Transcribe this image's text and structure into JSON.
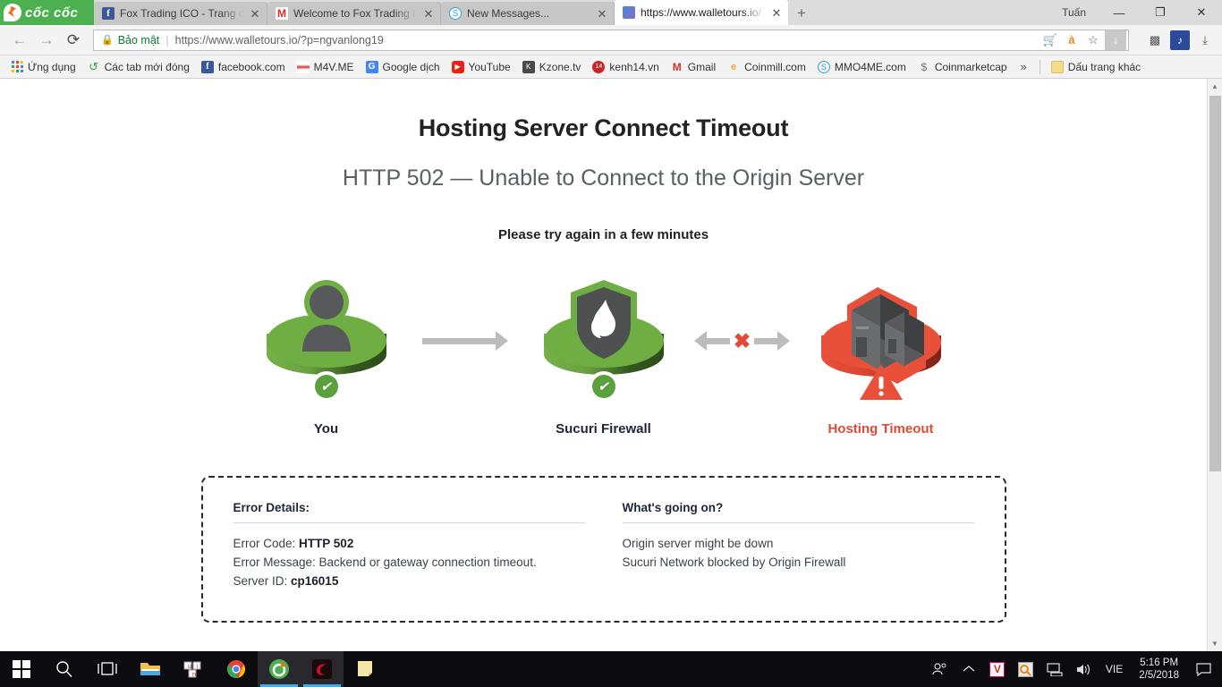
{
  "window": {
    "brand": "cốc cốc",
    "user": "Tuấn",
    "minimize": "—",
    "maximize": "❐",
    "close": "✕"
  },
  "tabs": [
    {
      "title": "Fox Trading ICO - Trang ch",
      "favicon": "facebook-icon",
      "close": "✕",
      "active": false
    },
    {
      "title": "Welcome to Fox Trading IC",
      "favicon": "gmail-icon",
      "close": "✕",
      "active": false
    },
    {
      "title": "New Messages...",
      "favicon": "skype-icon",
      "close": "✕",
      "active": false
    },
    {
      "title": "https://www.walletours.io/",
      "favicon": "walletours-icon",
      "close": "✕",
      "active": true
    }
  ],
  "newtab_label": "+",
  "nav": {
    "back": "←",
    "forward": "→",
    "reload": "⟳",
    "lock_icon": "lock-icon",
    "secure_label": "Bảo mật",
    "separator": "|",
    "url_scheme": "https://",
    "url_host": "www.walletours.io",
    "url_path": "/?p=ngvanlong19",
    "url_full": "https://www.walletours.io/?p=ngvanlong19",
    "actions": [
      {
        "name": "shopping-cart-icon",
        "glyph": "🛒"
      },
      {
        "name": "translate-icon",
        "glyph": "à"
      },
      {
        "name": "bookmark-star-icon",
        "glyph": "☆"
      },
      {
        "name": "download-arrow-icon",
        "glyph": "↓"
      }
    ],
    "extensions": [
      {
        "name": "qr-code-icon",
        "glyph": "▩"
      },
      {
        "name": "blue-extension-icon",
        "glyph": "♪"
      },
      {
        "name": "downloads-icon",
        "glyph": "⤓"
      }
    ]
  },
  "bookmarks": {
    "items": [
      {
        "label": "Ứng dụng",
        "icon": "apps-grid-icon"
      },
      {
        "label": "Các tab mới đóng",
        "icon": "history-icon"
      },
      {
        "label": "facebook.com",
        "icon": "facebook-icon"
      },
      {
        "label": "M4V.ME",
        "icon": "m4v-icon"
      },
      {
        "label": "Google dịch",
        "icon": "google-translate-icon"
      },
      {
        "label": "YouTube",
        "icon": "youtube-icon"
      },
      {
        "label": "Kzone.tv",
        "icon": "kzone-icon"
      },
      {
        "label": "kenh14.vn",
        "icon": "kenh14-icon"
      },
      {
        "label": "Gmail",
        "icon": "gmail-icon"
      },
      {
        "label": "Coinmill.com",
        "icon": "coinmill-icon"
      },
      {
        "label": "MMO4ME.com",
        "icon": "mmo4me-icon"
      },
      {
        "label": "Coinmarketcap",
        "icon": "coinmarketcap-icon"
      }
    ],
    "overflow": "»",
    "other_label": "Dấu trang khác",
    "other_icon": "folder-icon"
  },
  "page": {
    "title": "Hosting Server Connect Timeout",
    "subtitle": "HTTP 502 — Unable to Connect to the Origin Server",
    "retry": "Please try again in a few minutes",
    "flow": {
      "nodes": [
        {
          "label": "You",
          "icon": "user-icon",
          "status": "ok",
          "status_icon": "check-circle-icon"
        },
        {
          "label": "Sucuri Firewall",
          "icon": "shield-flame-icon",
          "status": "ok",
          "status_icon": "check-circle-icon"
        },
        {
          "label": "Hosting Timeout",
          "icon": "servers-icon",
          "status": "error",
          "status_icon": "warning-triangle-icon"
        }
      ],
      "connector1": "arrow-right-icon",
      "connector2": "blocked-arrows-icon",
      "x_glyph": "✖"
    },
    "details": {
      "left": {
        "heading": "Error Details:",
        "rows": [
          {
            "label": "Error Code:",
            "value": "HTTP 502",
            "bold": true
          },
          {
            "label": "Error Message:",
            "value": "Backend or gateway connection timeout.",
            "bold": false
          },
          {
            "label": "Server ID:",
            "value": "cp16015",
            "bold": true
          }
        ]
      },
      "right": {
        "heading": "What's going on?",
        "lines": [
          "Origin server might be down",
          "Sucuri Network blocked by Origin Firewall"
        ]
      }
    },
    "colors": {
      "ok_green": "#6fae43",
      "error_red": "#e9503a",
      "error_text": "#e04a36",
      "arrow_gray": "#bcbcbc"
    }
  },
  "scrollbar": {
    "up": "▲",
    "down": "▼"
  },
  "taskbar": {
    "start": "start-button",
    "items": [
      {
        "name": "search-icon",
        "glyph": "🔍"
      },
      {
        "name": "task-view-icon",
        "glyph": "❑"
      },
      {
        "name": "file-explorer-icon",
        "glyph": "📁"
      },
      {
        "name": "unikey-icon",
        "glyph": "u"
      },
      {
        "name": "chrome-icon",
        "glyph": "◎"
      },
      {
        "name": "coccoc-icon",
        "glyph": "◉"
      },
      {
        "name": "garena-icon",
        "glyph": "◈"
      },
      {
        "name": "notepad-icon",
        "glyph": "▤"
      }
    ],
    "tray": [
      {
        "name": "people-icon",
        "glyph": "👤"
      },
      {
        "name": "show-hidden-icons-icon",
        "glyph": "︿"
      },
      {
        "name": "unikey-tray-icon",
        "glyph": "V"
      },
      {
        "name": "antivirus-tray-icon",
        "glyph": "◉"
      },
      {
        "name": "network-icon",
        "glyph": "🖥"
      },
      {
        "name": "volume-icon",
        "glyph": "🔊"
      }
    ],
    "language": "VIE",
    "time": "5:16 PM",
    "date": "2/5/2018",
    "action_center": "💬"
  }
}
